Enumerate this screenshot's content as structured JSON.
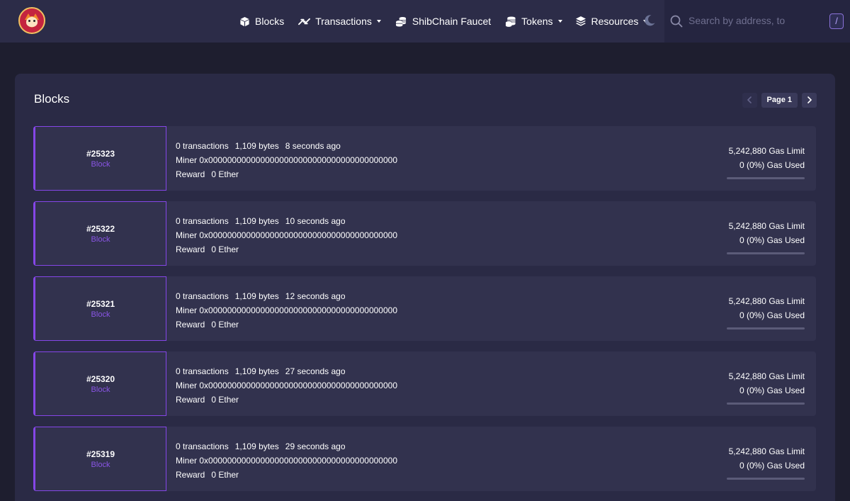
{
  "nav": {
    "items": [
      {
        "label": "Blocks",
        "icon": "cube-icon"
      },
      {
        "label": "Transactions",
        "icon": "arrows-swap-icon",
        "dropdown": true
      },
      {
        "label": "ShibChain Faucet",
        "icon": "coins-icon"
      },
      {
        "label": "Tokens",
        "icon": "coins-stack-icon",
        "dropdown": true
      },
      {
        "label": "Resources",
        "icon": "layers-icon",
        "dropdown": true
      }
    ],
    "theme_toggle_icon": "moon-icon",
    "search": {
      "placeholder": "Search by address, token symbol, name, transaction hash, or block number",
      "value": "",
      "shortcut": "/"
    }
  },
  "page": {
    "title": "Blocks",
    "pagination": {
      "label": "Page 1"
    }
  },
  "colors": {
    "accent": "#8546e8",
    "background": "#1e1e2f",
    "navbar": "#2c2c48",
    "card": "#2a2a45",
    "row": "#32324e"
  },
  "blocks": [
    {
      "number": "#25323",
      "type": "Block",
      "transactions": "0 transactions",
      "size": "1,109 bytes",
      "age": "8 seconds ago",
      "miner_label": "Miner",
      "miner": "0x0000000000000000000000000000000000000000",
      "reward_label": "Reward",
      "reward": "0 Ether",
      "gas_limit": "5,242,880 Gas Limit",
      "gas_used": "0 (0%) Gas Used",
      "gas_used_fraction": 0
    },
    {
      "number": "#25322",
      "type": "Block",
      "transactions": "0 transactions",
      "size": "1,109 bytes",
      "age": "10 seconds ago",
      "miner_label": "Miner",
      "miner": "0x0000000000000000000000000000000000000000",
      "reward_label": "Reward",
      "reward": "0 Ether",
      "gas_limit": "5,242,880 Gas Limit",
      "gas_used": "0 (0%) Gas Used",
      "gas_used_fraction": 0
    },
    {
      "number": "#25321",
      "type": "Block",
      "transactions": "0 transactions",
      "size": "1,109 bytes",
      "age": "12 seconds ago",
      "miner_label": "Miner",
      "miner": "0x0000000000000000000000000000000000000000",
      "reward_label": "Reward",
      "reward": "0 Ether",
      "gas_limit": "5,242,880 Gas Limit",
      "gas_used": "0 (0%) Gas Used",
      "gas_used_fraction": 0
    },
    {
      "number": "#25320",
      "type": "Block",
      "transactions": "0 transactions",
      "size": "1,109 bytes",
      "age": "27 seconds ago",
      "miner_label": "Miner",
      "miner": "0x0000000000000000000000000000000000000000",
      "reward_label": "Reward",
      "reward": "0 Ether",
      "gas_limit": "5,242,880 Gas Limit",
      "gas_used": "0 (0%) Gas Used",
      "gas_used_fraction": 0
    },
    {
      "number": "#25319",
      "type": "Block",
      "transactions": "0 transactions",
      "size": "1,109 bytes",
      "age": "29 seconds ago",
      "miner_label": "Miner",
      "miner": "0x0000000000000000000000000000000000000000",
      "reward_label": "Reward",
      "reward": "0 Ether",
      "gas_limit": "5,242,880 Gas Limit",
      "gas_used": "0 (0%) Gas Used",
      "gas_used_fraction": 0
    }
  ]
}
